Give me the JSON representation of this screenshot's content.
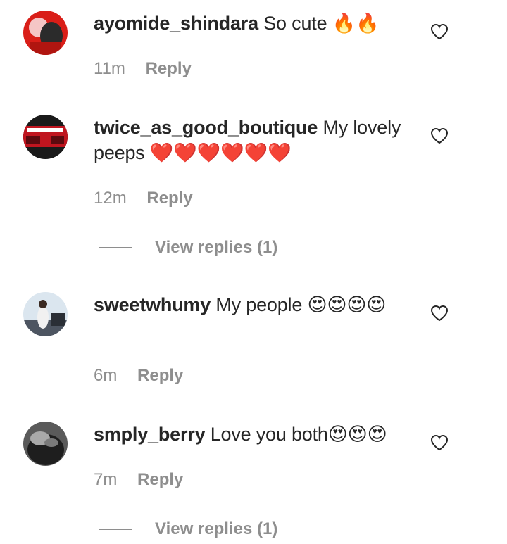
{
  "comments": [
    {
      "username": "ayomide_shindara",
      "text": "So cute 🔥🔥",
      "time": "11m",
      "reply_label": "Reply",
      "avatar_colors": [
        "#d91e18",
        "#f5c6c6",
        "#2b2b2b"
      ]
    },
    {
      "username": "twice_as_good_boutique",
      "text": "My lovely peeps ❤️❤️❤️❤️❤️❤️",
      "time": "12m",
      "reply_label": "Reply",
      "avatar_colors": [
        "#1a1a1a",
        "#c0151f",
        "#ffffff"
      ],
      "view_replies": "View replies (1)"
    },
    {
      "username": "sweetwhumy",
      "text": "My people 😍😍😍😍",
      "time": "6m",
      "reply_label": "Reply",
      "avatar_colors": [
        "#dbe6ef",
        "#4d5561",
        "#f1f1f1"
      ]
    },
    {
      "username": "smply_berry",
      "text": "Love you both😍😍😍",
      "time": "7m",
      "reply_label": "Reply",
      "avatar_colors": [
        "#5a5a5a",
        "#1e1e1e",
        "#a9a9a9"
      ],
      "view_replies": "View replies (1)"
    }
  ],
  "icons": {
    "like": "heart-outline-icon"
  },
  "colors": {
    "primary_text": "#262626",
    "secondary_text": "#8e8e8e",
    "background": "#ffffff"
  }
}
